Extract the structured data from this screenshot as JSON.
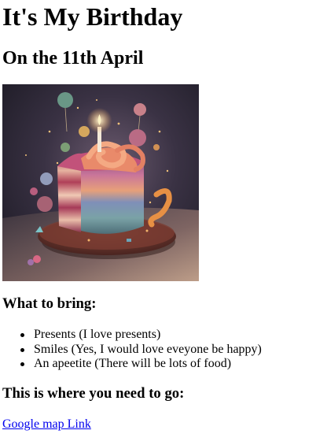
{
  "title": "It's My Birthday",
  "subtitle": "On the 11th April",
  "colors": {
    "link": "#0000ee",
    "text": "#000000"
  },
  "bring": {
    "heading": "What to bring:",
    "items": [
      "Presents (I love presents)",
      "Smiles (Yes, I would love eveyone be happy)",
      "An apeetite (There will be lots of food)"
    ]
  },
  "go": {
    "heading": "This is where you need to go:",
    "link_text": "Google map Link"
  }
}
